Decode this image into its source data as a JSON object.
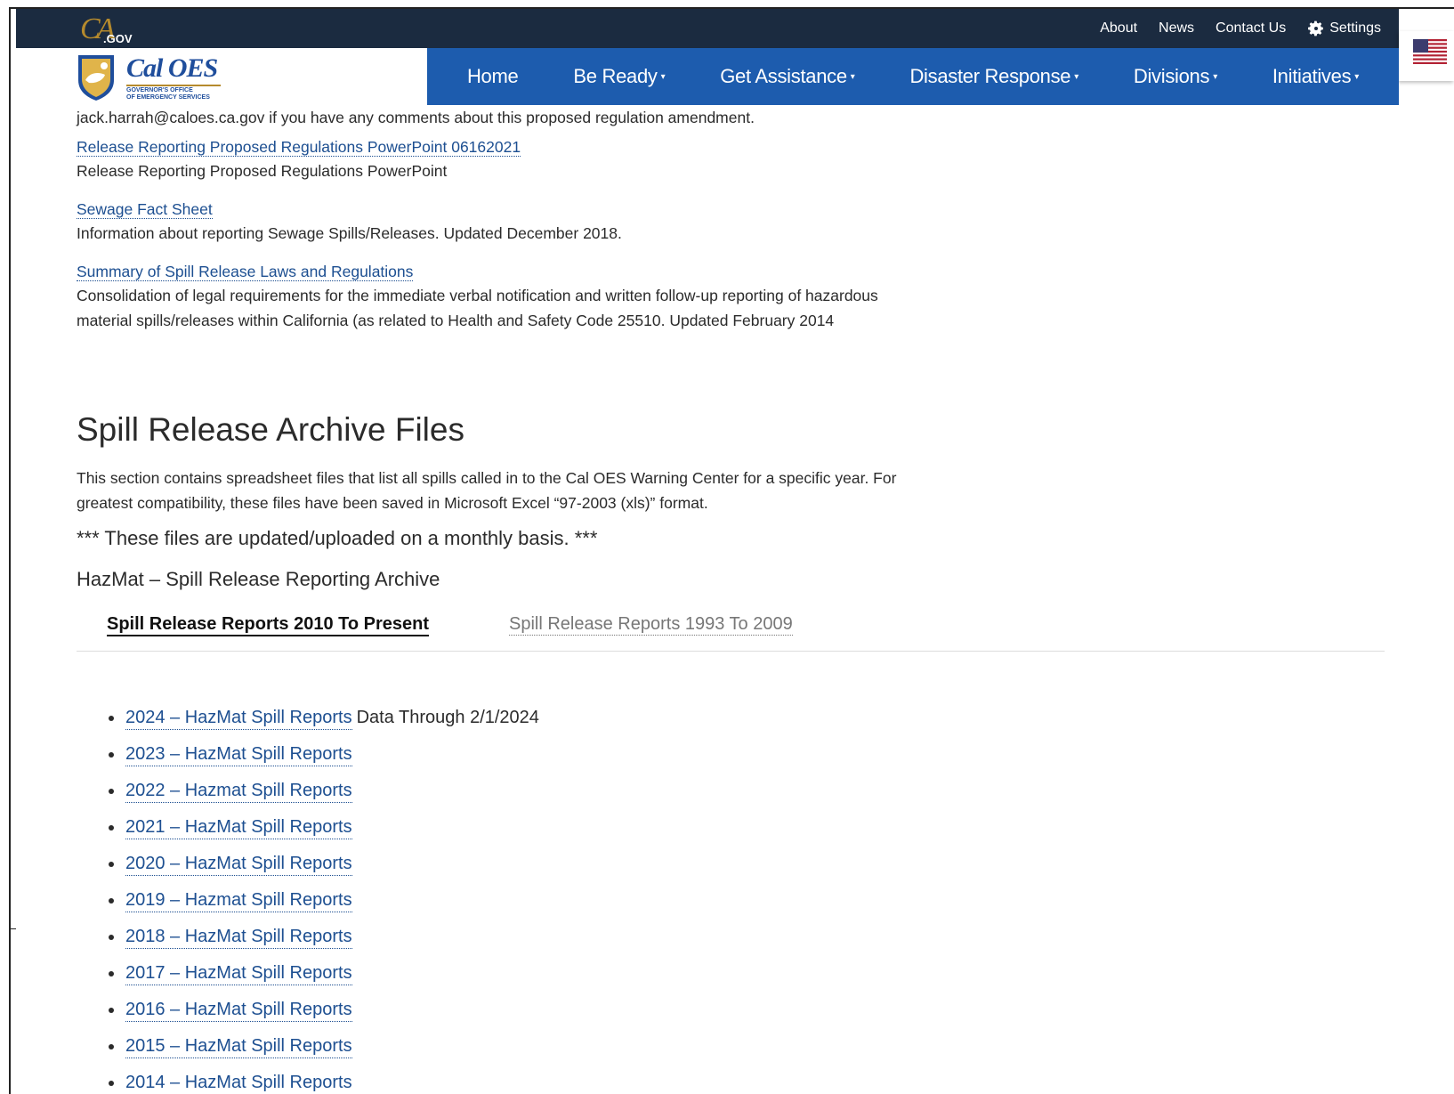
{
  "header": {
    "cagov_ca": "CA",
    "cagov_gov": ".GOV",
    "utility_links": [
      "About",
      "News",
      "Contact Us"
    ],
    "settings_label": "Settings",
    "brand_title": "Cal OES",
    "brand_sub_line1": "GOVERNOR'S OFFICE",
    "brand_sub_line2": "OF EMERGENCY SERVICES",
    "nav": {
      "home": "Home",
      "be_ready": "Be Ready",
      "get_assistance": "Get Assistance",
      "disaster_response": "Disaster Response",
      "divisions": "Divisions",
      "initiatives": "Initiatives"
    },
    "nav_caret": "▾"
  },
  "content": {
    "intro_line": "jack.harrah@caloes.ca.gov if you have any comments about this proposed regulation amendment.",
    "resources": [
      {
        "link": "Release Reporting Proposed Regulations PowerPoint 06162021",
        "desc": "Release Reporting Proposed Regulations PowerPoint"
      },
      {
        "link": "Sewage Fact Sheet",
        "desc": "Information about reporting Sewage Spills/Releases. Updated December 2018."
      },
      {
        "link": "Summary of Spill Release Laws and Regulations",
        "desc_line1": "Consolidation of legal requirements for the immediate verbal notification and written follow-up reporting of hazardous",
        "desc_line2": "material spills/releases within California (as related to Health and Safety Code 25510. Updated February 2014"
      }
    ],
    "section_title": "Spill Release Archive Files",
    "section_desc_line1": "This section contains spreadsheet files that list all spills called in to the Cal OES Warning Center for a specific year. For",
    "section_desc_line2": "greatest compatibility, these files have been saved in Microsoft Excel “97-2003 (xls)” format.",
    "notice": "*** These files are updated/uploaded on a monthly basis. ***",
    "subhead": "HazMat – Spill Release Reporting Archive",
    "tabs": {
      "active": "Spill Release Reports 2010 To Present",
      "inactive": "Spill Release Reports 1993 To 2009"
    },
    "reports": [
      {
        "label": "2024 – HazMat Spill Reports",
        "note": "Data Through 2/1/2024"
      },
      {
        "label": "2023 – HazMat Spill Reports"
      },
      {
        "label": "2022 – Hazmat Spill Reports"
      },
      {
        "label": "2021 – HazMat Spill Reports"
      },
      {
        "label": "2020 – HazMat Spill Reports"
      },
      {
        "label": "2019 – Hazmat Spill Reports"
      },
      {
        "label": "2018 – HazMat Spill Reports"
      },
      {
        "label": "2017 – HazMat Spill Reports"
      },
      {
        "label": "2016 – HazMat Spill Reports"
      },
      {
        "label": "2015 – HazMat Spill Reports"
      },
      {
        "label": "2014 – HazMat Spill Reports"
      }
    ]
  },
  "colors": {
    "utility_bar": "#1b2b40",
    "nav_bar": "#1d5cae",
    "link": "#1d4f91",
    "gold": "#b58a2d"
  },
  "icons": [
    "gear-icon",
    "us-flag-icon",
    "cal-oes-seal-icon",
    "chevron-down-icon"
  ]
}
